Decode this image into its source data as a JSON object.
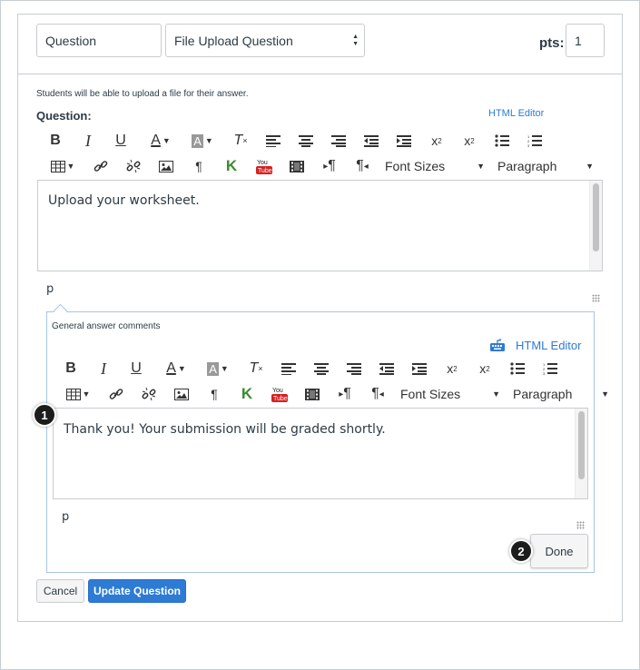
{
  "header": {
    "question_name": "Question",
    "question_type": "File Upload Question",
    "pts_label": "pts:",
    "pts_value": "1"
  },
  "question_section": {
    "intro": "Students will be able to upload a file for their answer.",
    "label": "Question:",
    "html_editor_link": "HTML Editor",
    "toolbar": {
      "font_sizes": "Font Sizes",
      "paragraph": "Paragraph"
    },
    "content": "Upload your worksheet.",
    "path": "p"
  },
  "comments_section": {
    "label": "General answer comments",
    "html_editor_link": "HTML Editor",
    "toolbar": {
      "font_sizes": "Font Sizes",
      "paragraph": "Paragraph"
    },
    "content": "Thank you! Your submission will be graded shortly.",
    "path": "p",
    "done_label": "Done"
  },
  "footer": {
    "cancel_label": "Cancel",
    "update_label": "Update Question"
  },
  "callouts": [
    "1",
    "2"
  ],
  "colors": {
    "link_blue": "#2d7bd4",
    "primary_button": "#2d7bd4",
    "border": "#c7cdd1",
    "callout": "#1c1c1c"
  }
}
